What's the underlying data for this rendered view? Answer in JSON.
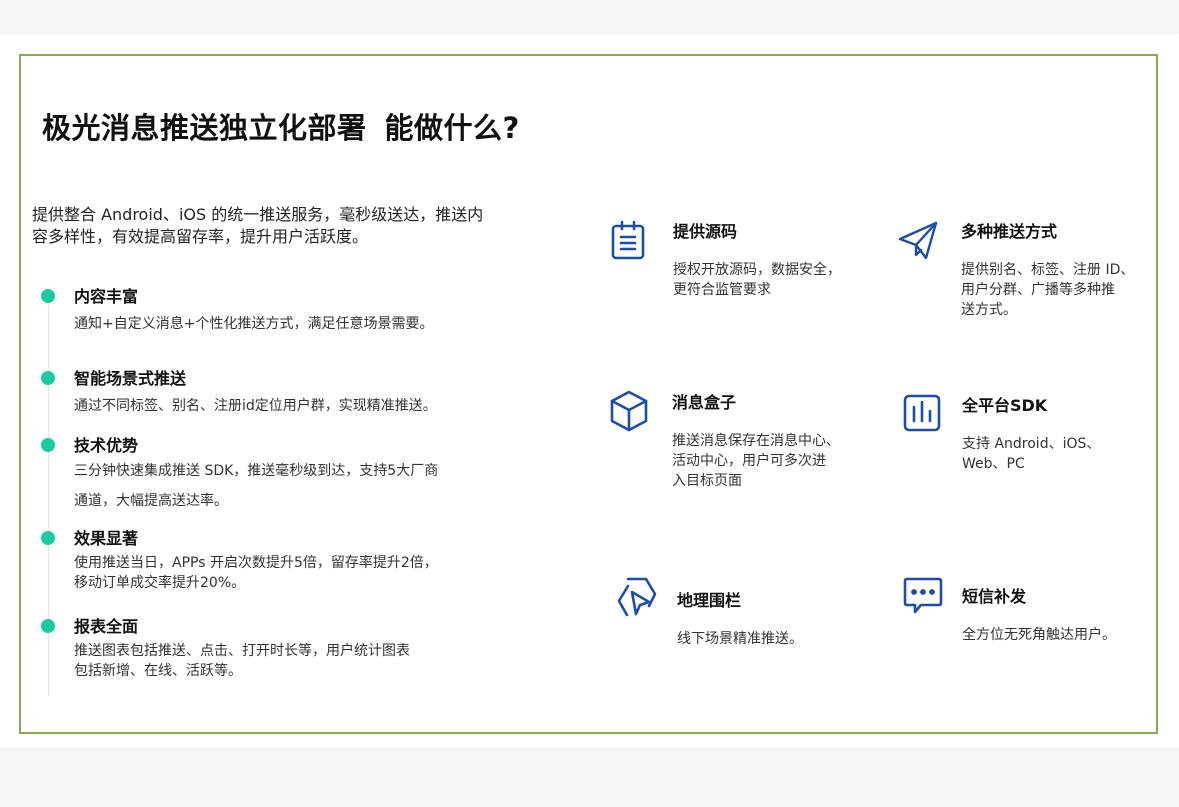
{
  "heading": {
    "part1": "极光消息推送独立化部署",
    "part2": "能做什么?"
  },
  "intro": {
    "line1": "提供整合 Android、iOS 的统一推送服务，毫秒级送达，推送内",
    "line2": "容多样性，有效提高留存率，提升用户活跃度。"
  },
  "features": [
    {
      "title": "内容丰富",
      "desc": [
        "通知+自定义消息+个性化推送方式，满足任意场景需要。"
      ]
    },
    {
      "title": "智能场景式推送",
      "desc": [
        "通过不同标签、别名、注册id定位用户群，实现精准推送。"
      ]
    },
    {
      "title": "技术优势",
      "desc": [
        "三分钟快速集成推送 SDK，推送毫秒级到达，支持5大厂商",
        "通道，大幅提高送达率。"
      ]
    },
    {
      "title": "效果显著",
      "desc": [
        "使用推送当日，APPs 开启次数提升5倍，留存率提升2倍，",
        "移动订单成交率提升20%。"
      ]
    },
    {
      "title": "报表全面",
      "desc": [
        "推送图表包括推送、点击、打开时长等，用户统计图表",
        "包括新增、在线、活跃等。"
      ]
    }
  ],
  "cards": [
    {
      "icon": "clipboard-list-icon",
      "title": "提供源码",
      "desc": [
        "授权开放源码，数据安全，",
        "更符合监管要求"
      ]
    },
    {
      "icon": "paper-plane-icon",
      "title": "多种推送方式",
      "desc": [
        "提供别名、标签、注册 ID、",
        "用户分群、广播等多种推",
        "送方式。"
      ]
    },
    {
      "icon": "cube-icon",
      "title": "消息盒子",
      "desc": [
        "推送消息保存在消息中心、",
        "活动中心，用户可多次进",
        "入目标页面"
      ]
    },
    {
      "icon": "bar-chart-icon",
      "title": "全平台SDK",
      "desc": [
        "支持 Android、iOS、",
        "Web、PC"
      ]
    },
    {
      "icon": "geofence-icon",
      "title": "地理围栏",
      "desc": [
        "线下场景精准推送。"
      ]
    },
    {
      "icon": "chat-bubble-icon",
      "title": "短信补发",
      "desc": [
        "全方位无死角触达用户。"
      ]
    }
  ],
  "colors": {
    "frame_border": "#82ad55",
    "timeline_dot": "#19cba4",
    "icon_blue": "#1a4dae"
  }
}
